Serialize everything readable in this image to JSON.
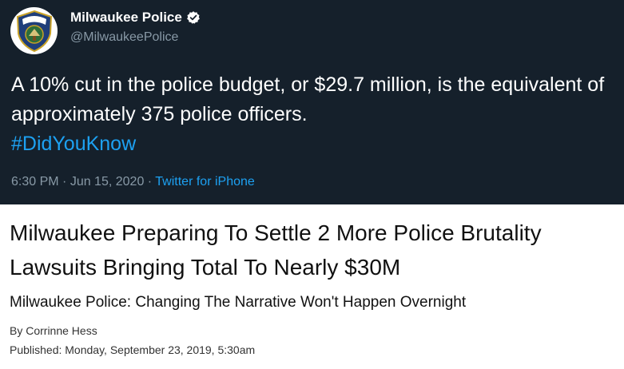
{
  "tweet": {
    "display_name": "Milwaukee Police",
    "handle": "@MilwaukeePolice",
    "text": "A 10% cut in the police budget, or $29.7 million, is the equivalent of approximately 375 police officers.",
    "hashtag": "#DidYouKnow",
    "time": "6:30 PM",
    "separator_1": " · ",
    "date": "Jun 15, 2020",
    "separator_2": " · ",
    "source": "Twitter for iPhone",
    "avatar_icon": "police-badge-icon",
    "verified_icon": "verified-badge-icon",
    "avatar_text": "MILWAUKEE POLICE"
  },
  "article": {
    "headline": "Milwaukee Preparing To Settle 2 More Police Brutality Lawsuits Bringing Total To Nearly $30M",
    "subheadline": "Milwaukee Police: Changing The Narrative Won't Happen Overnight",
    "byline": "By Corrinne Hess",
    "published": "Published: Monday, September 23, 2019, 5:30am"
  },
  "colors": {
    "tweet_background": "#15202b",
    "link_blue": "#1da1f2",
    "muted_gray": "#8899a6"
  }
}
